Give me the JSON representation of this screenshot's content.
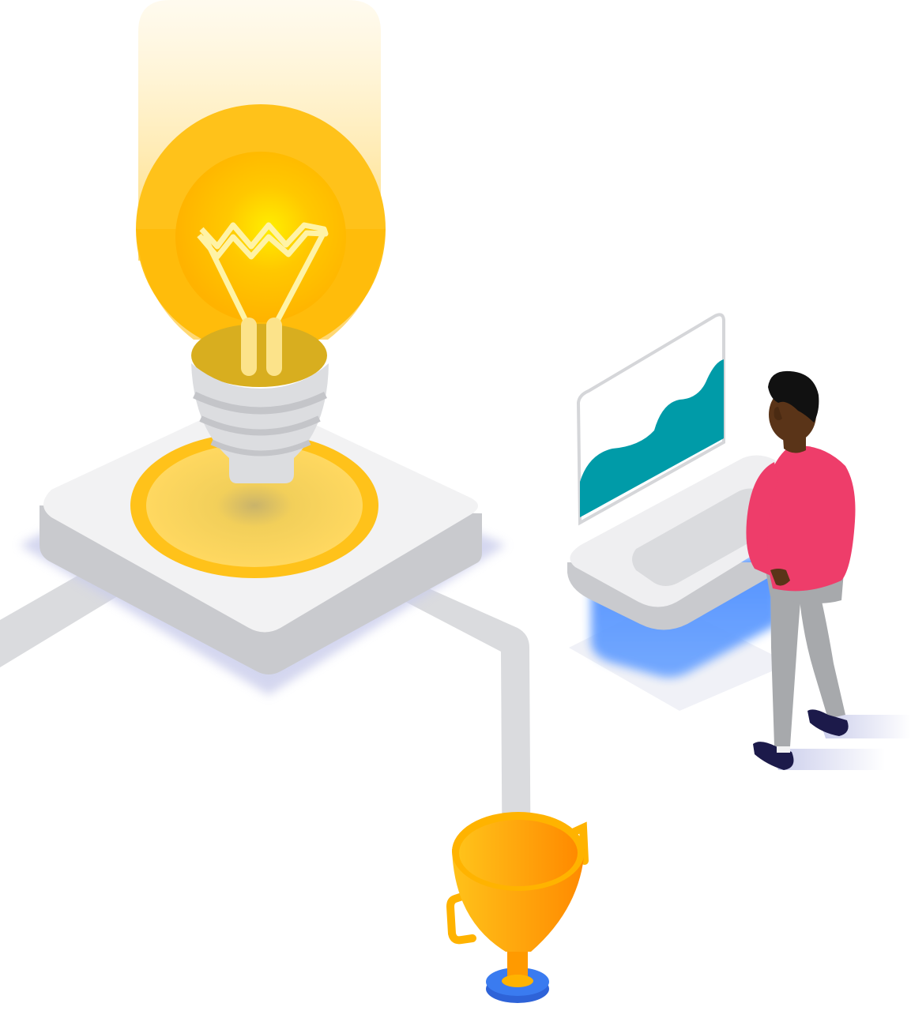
{
  "illustration": {
    "elements": [
      "light-bulb",
      "isometric-platform",
      "connector-pipes",
      "trophy",
      "chart-monitor-kiosk",
      "person"
    ],
    "colors": {
      "bulb_yellow": "#FFC21A",
      "bulb_glow": "#FFE08A",
      "platform_top": "#F2F2F3",
      "platform_side": "#C9CACE",
      "pipe_gray": "#DADBDE",
      "trophy_orange": "#FF9A00",
      "trophy_base_blue": "#3A7BF0",
      "chart_teal": "#009BA8",
      "kiosk_blue": "#4A8CFF",
      "shirt_pink": "#EE3D6A",
      "pants_gray": "#A7A9AC",
      "skin_dark": "#5A3418",
      "hair_black": "#111111",
      "shoes_navy": "#1C1A4A"
    }
  }
}
